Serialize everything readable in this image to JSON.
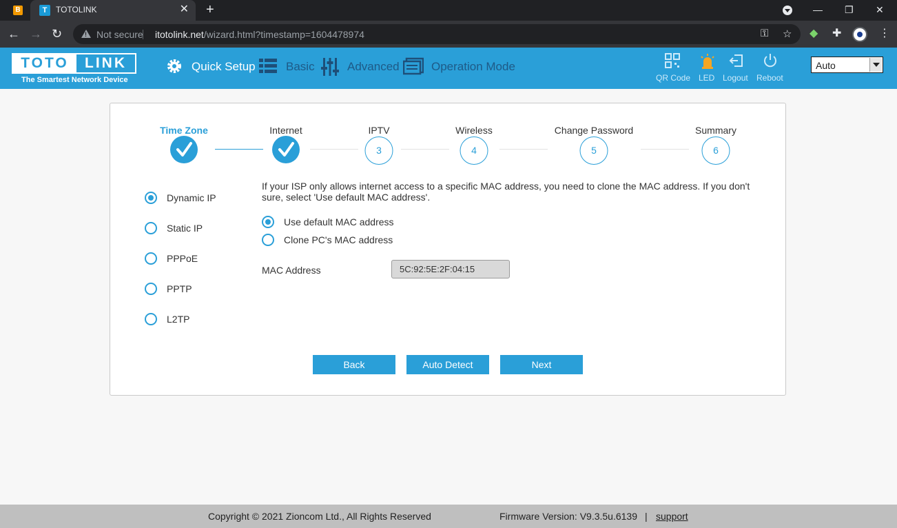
{
  "browser": {
    "tab_title": "TOTOLINK",
    "security_label": "Not secure",
    "url_host": "itotolink.net",
    "url_path": "/wizard.html?timestamp=1604478974"
  },
  "header": {
    "logo_left": "TOTO",
    "logo_right": "LINK",
    "tagline": "The Smartest Network Device",
    "nav": [
      {
        "label": "Quick Setup",
        "icon": "gear-icon"
      },
      {
        "label": "Basic",
        "icon": "list-icon"
      },
      {
        "label": "Advanced",
        "icon": "sliders-icon"
      },
      {
        "label": "Operation Mode",
        "icon": "mode-icon"
      }
    ],
    "tools": [
      {
        "label": "QR Code",
        "icon": "qr-code-icon"
      },
      {
        "label": "LED",
        "icon": "led-icon"
      },
      {
        "label": "Logout",
        "icon": "logout-icon"
      },
      {
        "label": "Reboot",
        "icon": "power-icon"
      }
    ],
    "mode_select": "Auto"
  },
  "wizard": {
    "steps": [
      {
        "label": "Time Zone",
        "state": "done",
        "num": "1"
      },
      {
        "label": "Internet",
        "state": "done",
        "num": "2"
      },
      {
        "label": "IPTV",
        "state": "todo",
        "num": "3"
      },
      {
        "label": "Wireless",
        "state": "todo",
        "num": "4"
      },
      {
        "label": "Change Password",
        "state": "todo",
        "num": "5"
      },
      {
        "label": "Summary",
        "state": "todo",
        "num": "6"
      }
    ],
    "connection_types": [
      "Dynamic IP",
      "Static IP",
      "PPPoE",
      "PPTP",
      "L2TP"
    ],
    "selected_connection": "Dynamic IP",
    "info_text": "If your ISP only allows internet access to a specific MAC address, you need to clone the MAC address. If you don't sure, select 'Use default MAC address'.",
    "mac_options": [
      "Use default MAC address",
      "Clone PC's MAC address"
    ],
    "selected_mac_option": "Use default MAC address",
    "mac_label": "MAC Address",
    "mac_value": "5C:92:5E:2F:04:15",
    "buttons": {
      "back": "Back",
      "auto_detect": "Auto Detect",
      "next": "Next"
    }
  },
  "footer": {
    "copyright": "Copyright © 2021 Zioncom Ltd., All Rights Reserved",
    "firmware": "Firmware Version: V9.3.5u.6139",
    "separator": "|",
    "support": "support"
  },
  "colors": {
    "accent": "#2a9fd8",
    "header_inactive_text": "#cdeafa",
    "footer_bg": "#bfbfbf"
  }
}
